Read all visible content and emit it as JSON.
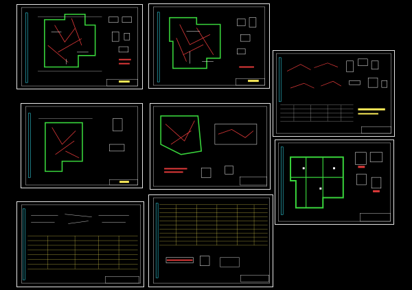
{
  "canvas": {
    "background": "#000000"
  },
  "colors": {
    "frame": "#e6e6e6",
    "wall": "#39d63c",
    "pipe": "#e43a3a",
    "line": "#ffffff",
    "cyan": "#33d6e6",
    "yellow": "#ffef5a",
    "magenta": "#d83ad8"
  },
  "sheets": [
    {
      "id": "s1",
      "kind": "plan-red"
    },
    {
      "id": "s2",
      "kind": "plan-red"
    },
    {
      "id": "s3",
      "kind": "details"
    },
    {
      "id": "s4",
      "kind": "plan-red"
    },
    {
      "id": "s5",
      "kind": "plan-red"
    },
    {
      "id": "s6",
      "kind": "plan-green"
    },
    {
      "id": "s7",
      "kind": "table"
    },
    {
      "id": "s8",
      "kind": "table"
    }
  ]
}
